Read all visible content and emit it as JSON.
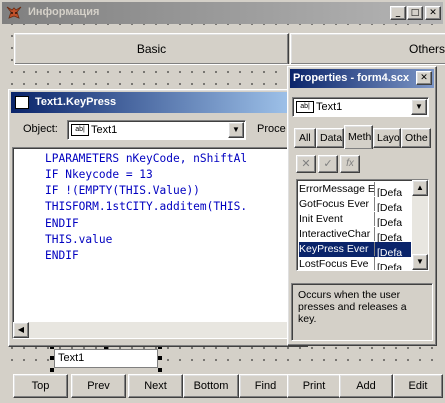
{
  "main_window": {
    "title": "Информация",
    "tabs": [
      "Basic",
      "Others"
    ],
    "field_value": "Text1",
    "nav_buttons": [
      "Top",
      "Prev",
      "Next",
      "Bottom",
      "Find",
      "Print",
      "Add",
      "Edit"
    ]
  },
  "code_window": {
    "title": "Text1.KeyPress",
    "object_label": "Object:",
    "object_value": "Text1",
    "proc_label": "Proce",
    "code_lines": [
      "LPARAMETERS nKeyCode, nShiftAl",
      "IF Nkeycode = 13",
      "IF !(EMPTY(THIS.Value))",
      "THISFORM.1stCITY.additem(THIS.",
      "ENDIF",
      "THIS.value",
      "ENDIF"
    ]
  },
  "properties": {
    "title": "Properties - form4.scx",
    "object_value": "Text1",
    "tabs": [
      "All",
      "Data",
      "Meth",
      "Layo",
      "Othe"
    ],
    "active_tab_index": 2,
    "rows": [
      {
        "name": "ErrorMessage E",
        "value": "[Defa"
      },
      {
        "name": "GotFocus Ever",
        "value": "[Defa"
      },
      {
        "name": "Init Event",
        "value": "[Defa"
      },
      {
        "name": "InteractiveChar",
        "value": "[Defa"
      },
      {
        "name": "KeyPress Ever",
        "value": "[Defa"
      },
      {
        "name": "LostFocus Eve",
        "value": "[Defa"
      }
    ],
    "selected_row_index": 4,
    "description": "Occurs when the user presses and releases a key."
  },
  "icons": {
    "app": "fox-icon",
    "textbox": "textbox-icon",
    "fx": "fx"
  }
}
